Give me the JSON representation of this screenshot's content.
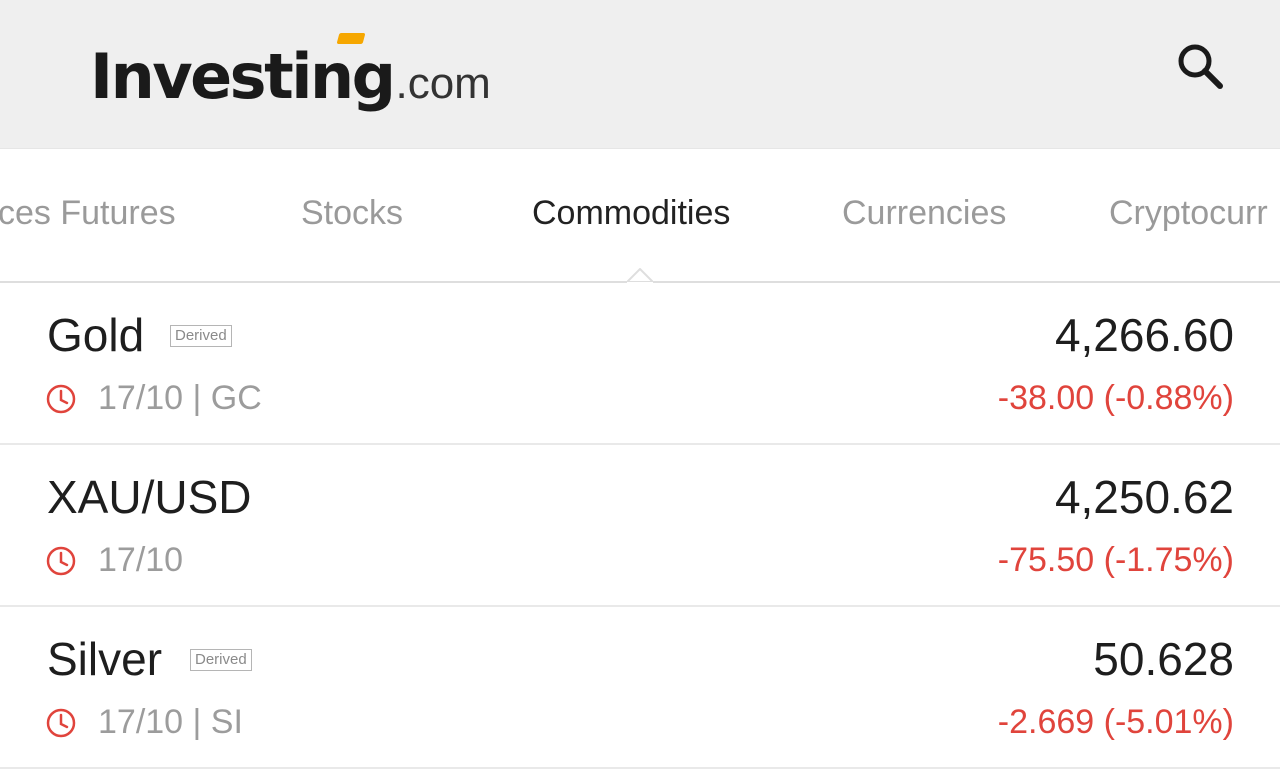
{
  "header": {
    "logo_main": "Investing",
    "logo_suffix": ".com"
  },
  "tabs": [
    {
      "label": "ces Futures",
      "active": false
    },
    {
      "label": "Stocks",
      "active": false
    },
    {
      "label": "Commodities",
      "active": true
    },
    {
      "label": "Currencies",
      "active": false
    },
    {
      "label": "Cryptocurr",
      "active": false
    }
  ],
  "instruments": [
    {
      "name": "Gold",
      "badge": "Derived",
      "meta": "17/10 | GC",
      "price": "4,266.60",
      "change": "-38.00 (-0.88%)"
    },
    {
      "name": "XAU/USD",
      "badge": "",
      "meta": "17/10",
      "price": "4,250.62",
      "change": "-75.50 (-1.75%)"
    },
    {
      "name": "Silver",
      "badge": "Derived",
      "meta": "17/10 | SI",
      "price": "50.628",
      "change": "-2.669 (-5.01%)"
    }
  ],
  "colors": {
    "header_bg": "#efefef",
    "accent": "#f6a700",
    "negative": "#e0443c",
    "clock": "#e0443c"
  },
  "icons": {
    "search": "search-icon",
    "clock": "clock-icon"
  }
}
